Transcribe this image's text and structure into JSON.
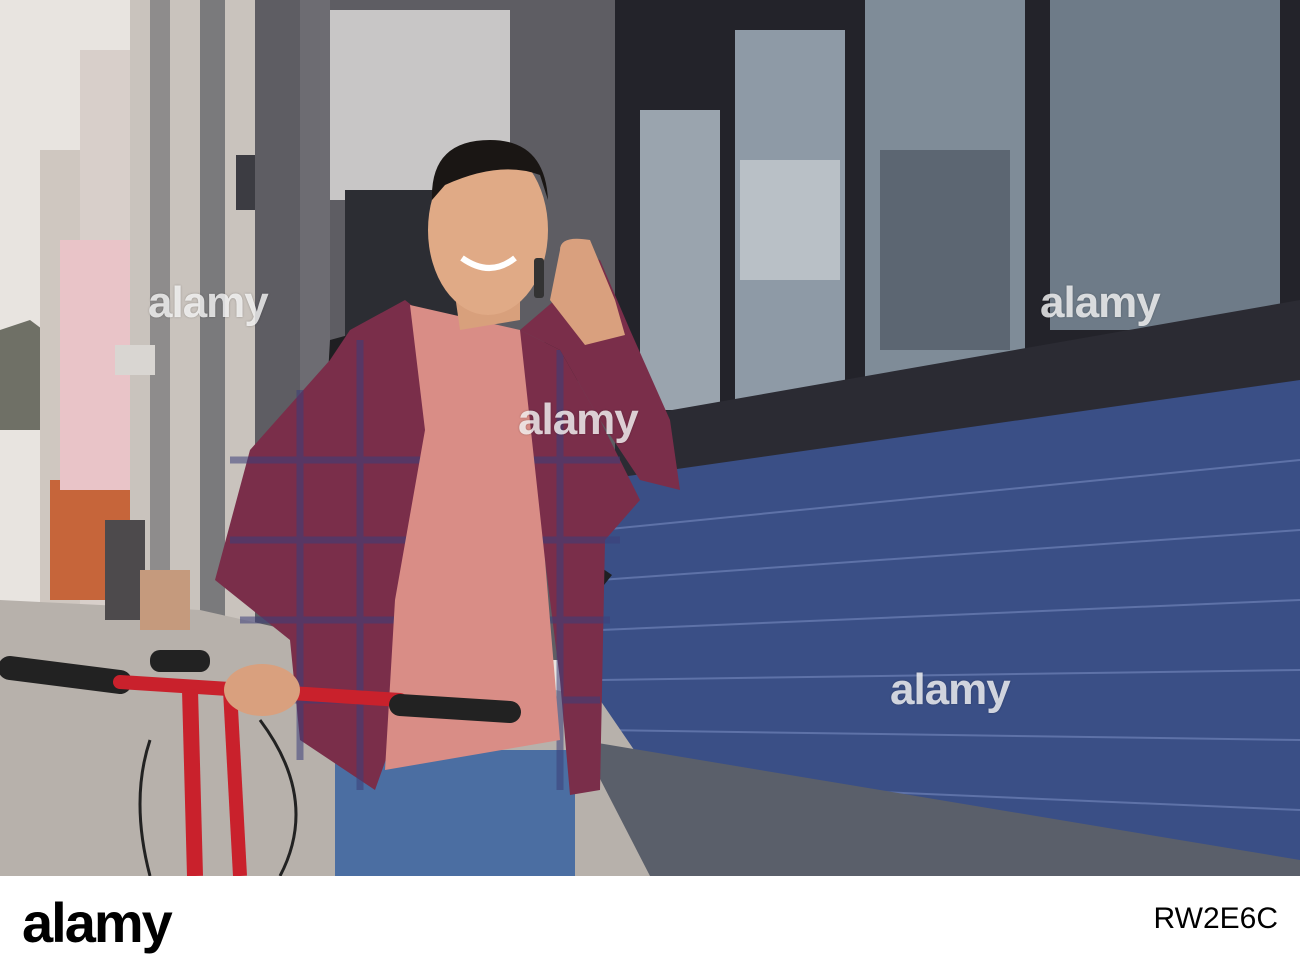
{
  "photo": {
    "description_icon": "photo-street-scene",
    "watermark_text": "alamy",
    "colors": {
      "wall_blue": "#3a4f86",
      "window_frame": "#1f1f24",
      "shirt_plaid": "#7a2e4a",
      "tshirt_pink": "#d98d86",
      "jeans": "#4a6da0",
      "bike_red": "#c9212c",
      "pavement": "#b7b1ab",
      "sky": "#e7e3df"
    }
  },
  "footer": {
    "brand": "alamy",
    "stock_id": "RW2E6C"
  }
}
